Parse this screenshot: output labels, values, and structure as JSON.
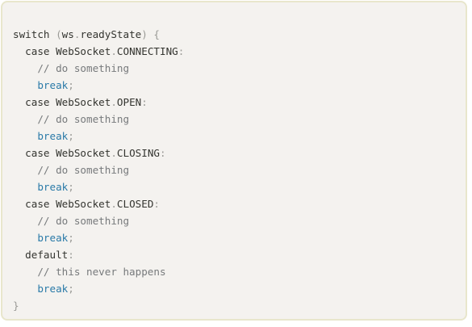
{
  "code": {
    "language": "javascript",
    "lines": [
      {
        "tokens": [
          {
            "t": "switch ",
            "c": "plain"
          },
          {
            "t": "(",
            "c": "punct"
          },
          {
            "t": "ws",
            "c": "plain"
          },
          {
            "t": ".",
            "c": "punct"
          },
          {
            "t": "readyState",
            "c": "plain"
          },
          {
            "t": ") {",
            "c": "punct"
          }
        ]
      },
      {
        "tokens": [
          {
            "t": "  case WebSocket",
            "c": "plain"
          },
          {
            "t": ".",
            "c": "punct"
          },
          {
            "t": "CONNECTING",
            "c": "plain"
          },
          {
            "t": ":",
            "c": "punct"
          }
        ]
      },
      {
        "tokens": [
          {
            "t": "    // do something",
            "c": "comment"
          }
        ]
      },
      {
        "tokens": [
          {
            "t": "    break",
            "c": "kw"
          },
          {
            "t": ";",
            "c": "punct"
          }
        ]
      },
      {
        "tokens": [
          {
            "t": "  case WebSocket",
            "c": "plain"
          },
          {
            "t": ".",
            "c": "punct"
          },
          {
            "t": "OPEN",
            "c": "plain"
          },
          {
            "t": ":",
            "c": "punct"
          }
        ]
      },
      {
        "tokens": [
          {
            "t": "    // do something",
            "c": "comment"
          }
        ]
      },
      {
        "tokens": [
          {
            "t": "    break",
            "c": "kw"
          },
          {
            "t": ";",
            "c": "punct"
          }
        ]
      },
      {
        "tokens": [
          {
            "t": "  case WebSocket",
            "c": "plain"
          },
          {
            "t": ".",
            "c": "punct"
          },
          {
            "t": "CLOSING",
            "c": "plain"
          },
          {
            "t": ":",
            "c": "punct"
          }
        ]
      },
      {
        "tokens": [
          {
            "t": "    // do something",
            "c": "comment"
          }
        ]
      },
      {
        "tokens": [
          {
            "t": "    break",
            "c": "kw"
          },
          {
            "t": ";",
            "c": "punct"
          }
        ]
      },
      {
        "tokens": [
          {
            "t": "  case WebSocket",
            "c": "plain"
          },
          {
            "t": ".",
            "c": "punct"
          },
          {
            "t": "CLOSED",
            "c": "plain"
          },
          {
            "t": ":",
            "c": "punct"
          }
        ]
      },
      {
        "tokens": [
          {
            "t": "    // do something",
            "c": "comment"
          }
        ]
      },
      {
        "tokens": [
          {
            "t": "    break",
            "c": "kw"
          },
          {
            "t": ";",
            "c": "punct"
          }
        ]
      },
      {
        "tokens": [
          {
            "t": "  default",
            "c": "plain"
          },
          {
            "t": ":",
            "c": "punct"
          }
        ]
      },
      {
        "tokens": [
          {
            "t": "    // this never happens",
            "c": "comment"
          }
        ]
      },
      {
        "tokens": [
          {
            "t": "    break",
            "c": "kw"
          },
          {
            "t": ";",
            "c": "punct"
          }
        ]
      },
      {
        "tokens": [
          {
            "t": "}",
            "c": "punct"
          }
        ]
      }
    ]
  },
  "colors": {
    "background": "#f4f2ef",
    "border": "#e8e6cc",
    "text": "#33342f",
    "punctuation": "#9a9a96",
    "comment": "#777a7c",
    "keyword": "#2a7aa8"
  }
}
